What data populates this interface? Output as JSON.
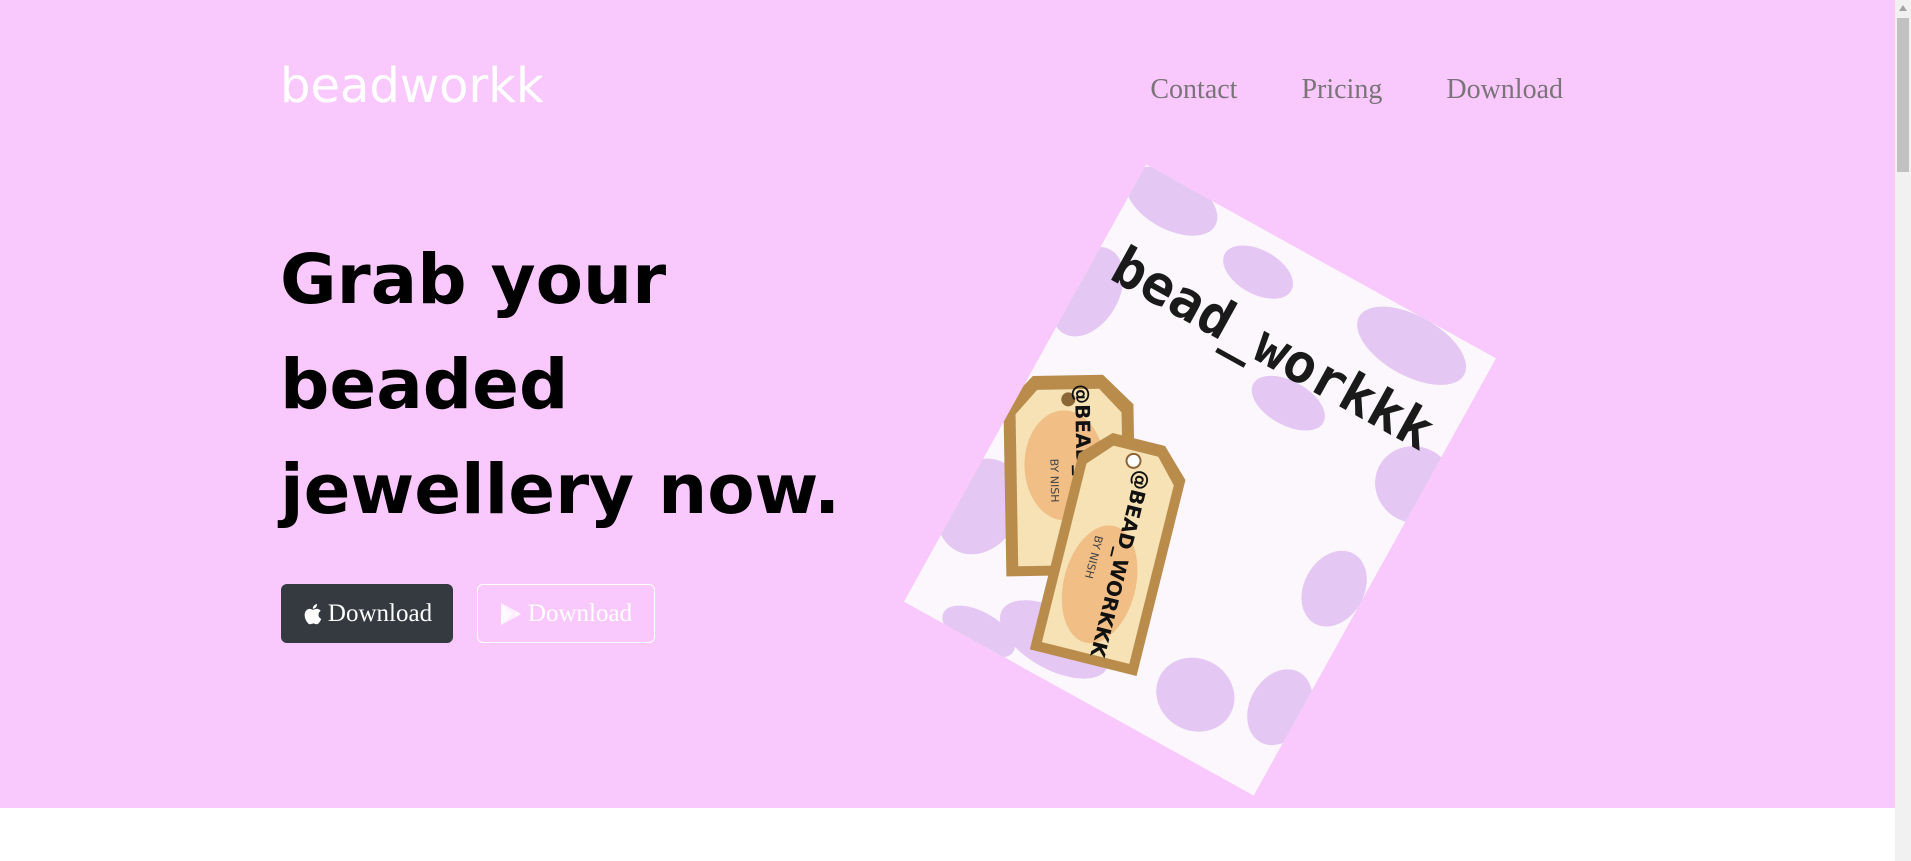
{
  "brand": "beadworkk",
  "nav": [
    {
      "label": "Contact"
    },
    {
      "label": "Pricing"
    },
    {
      "label": "Download"
    }
  ],
  "hero": {
    "headline_lines": [
      "Grab your",
      "beaded",
      "jewellery now."
    ],
    "buttons": [
      {
        "label": "Download",
        "icon": "apple-icon"
      },
      {
        "label": "Download",
        "icon": "google-play-icon"
      }
    ]
  },
  "image": {
    "card_text": "bead_workkk",
    "tag1_handle": "@BEAD_WORKKK",
    "tag1_sub": "BY NISH",
    "tag2_handle": "@BEAD_WORKKK",
    "tag2_sub": "BY NISH"
  },
  "colors": {
    "hero_bg": "#f9c9fd",
    "dark_button": "#343a40",
    "nav_text": "#7a7479"
  }
}
